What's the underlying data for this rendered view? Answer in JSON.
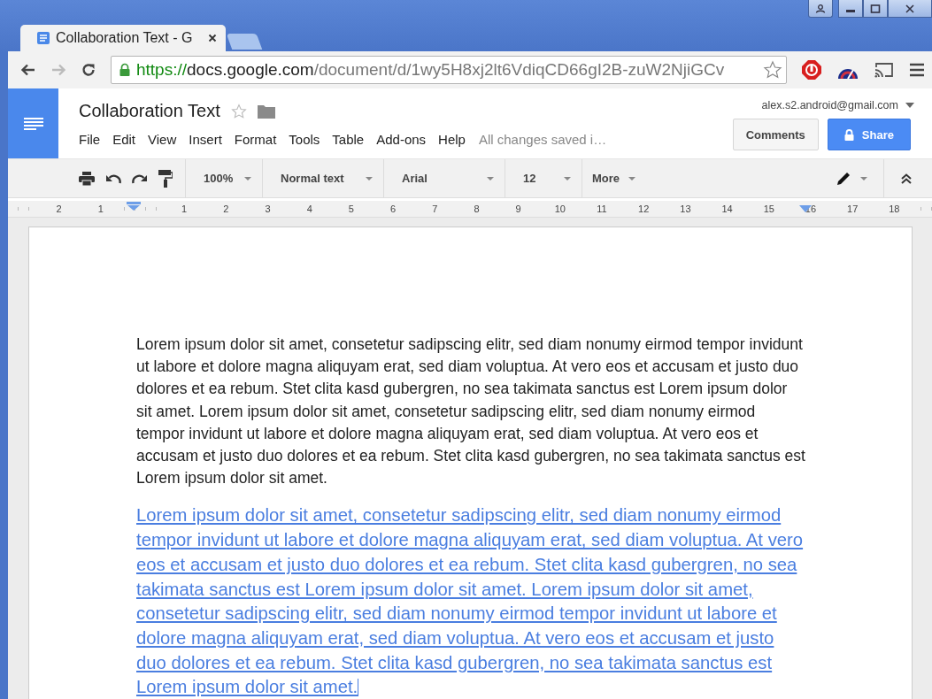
{
  "browser": {
    "tab": {
      "title": "Collaboration Text - G",
      "selected": true
    },
    "url": {
      "scheme": "https://",
      "host": "docs.google.com",
      "path": "/document/d/1wy5H8xj2lt6VdiqCD66gI2B-zuW2NjiGCv"
    }
  },
  "doc": {
    "title": "Collaboration Text",
    "account": "alex.s2.android@gmail.com",
    "menu": [
      "File",
      "Edit",
      "View",
      "Insert",
      "Format",
      "Tools",
      "Table",
      "Add-ons",
      "Help"
    ],
    "save_status": "All changes saved i…",
    "comments_button": "Comments",
    "share_button": "Share"
  },
  "toolbar": {
    "zoom": "100%",
    "style": "Normal text",
    "font": "Arial",
    "size": "12",
    "more": "More"
  },
  "ruler": [
    "2",
    "1",
    "1",
    "2",
    "3",
    "4",
    "5",
    "6",
    "7",
    "8",
    "9",
    "10",
    "11",
    "12",
    "13",
    "14",
    "15",
    "16",
    "17",
    "18"
  ],
  "paragraphs": [
    {
      "kind": "plain",
      "text": "Lorem ipsum dolor sit amet, consetetur sadipscing elitr, sed diam nonumy eirmod tempor invidunt ut labore et dolore magna aliquyam erat, sed diam voluptua. At vero eos et accusam et justo duo dolores et ea rebum. Stet clita kasd gubergren, no sea takimata sanctus est Lorem ipsum dolor sit amet. Lorem ipsum dolor sit amet, consetetur sadipscing elitr, sed diam nonumy eirmod tempor invidunt ut labore et dolore magna aliquyam erat, sed diam voluptua. At vero eos et accusam et justo duo dolores et ea rebum. Stet clita kasd gubergren, no sea takimata sanctus est Lorem ipsum dolor sit amet.",
      "cursor": false
    },
    {
      "kind": "collaborator",
      "color": "#4a7ee0",
      "text": "Lorem ipsum dolor sit amet, consetetur sadipscing elitr, sed diam nonumy eirmod tempor invidunt ut labore et dolore magna aliquyam erat, sed diam voluptua. At vero eos et accusam et justo duo dolores et ea rebum. Stet clita kasd gubergren, no sea takimata sanctus est Lorem ipsum dolor sit amet. Lorem ipsum dolor sit amet, consetetur sadipscing elitr, sed diam nonumy eirmod tempor invidunt ut labore et dolore magna aliquyam erat, sed diam voluptua. At vero eos et accusam et justo duo dolores et ea rebum. Stet clita kasd gubergren, no sea takimata sanctus est Lorem ipsum dolor sit amet.",
      "cursor": true
    }
  ]
}
